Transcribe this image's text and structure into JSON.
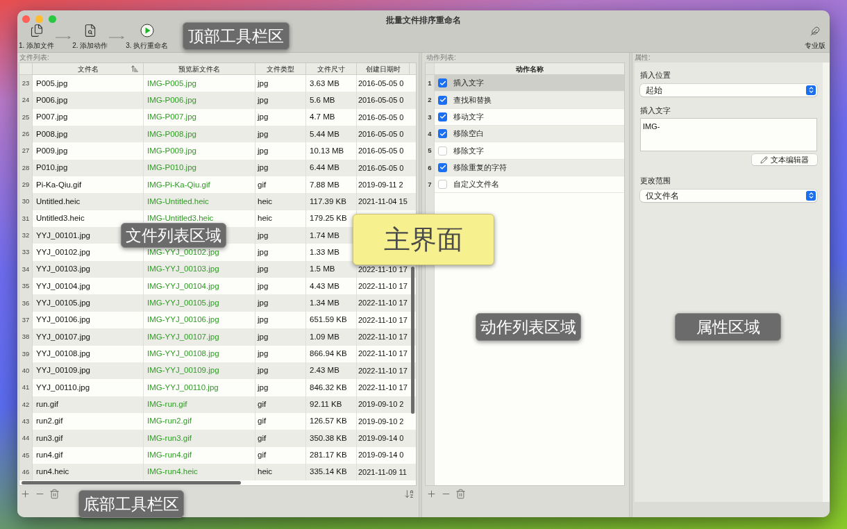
{
  "window": {
    "title": "批量文件排序重命名"
  },
  "toolbar": {
    "steps": [
      {
        "kind": "files",
        "label": "1. 添加文件"
      },
      {
        "kind": "actions",
        "label": "2. 添加动作"
      },
      {
        "kind": "run",
        "label": "3. 执行重命名"
      }
    ],
    "pro": {
      "label": "专业版"
    }
  },
  "file_list": {
    "label": "文件列表:",
    "columns": [
      {
        "label": "文件名",
        "sorted": true
      },
      {
        "label": "预览新文件名",
        "sorted": false
      },
      {
        "label": "文件类型",
        "sorted": false
      },
      {
        "label": "文件尺寸",
        "sorted": false
      },
      {
        "label": "创建日期时",
        "sorted": false
      }
    ],
    "rows": [
      {
        "index": "23",
        "name": "P005.jpg",
        "preview": "IMG-P005.jpg",
        "type": "jpg",
        "size": "3.63 MB",
        "created": "2016-05-05 0"
      },
      {
        "index": "24",
        "name": "P006.jpg",
        "preview": "IMG-P006.jpg",
        "type": "jpg",
        "size": "5.6 MB",
        "created": "2016-05-05 0"
      },
      {
        "index": "25",
        "name": "P007.jpg",
        "preview": "IMG-P007.jpg",
        "type": "jpg",
        "size": "4.7 MB",
        "created": "2016-05-05 0"
      },
      {
        "index": "26",
        "name": "P008.jpg",
        "preview": "IMG-P008.jpg",
        "type": "jpg",
        "size": "5.44 MB",
        "created": "2016-05-05 0"
      },
      {
        "index": "27",
        "name": "P009.jpg",
        "preview": "IMG-P009.jpg",
        "type": "jpg",
        "size": "10.13 MB",
        "created": "2016-05-05 0"
      },
      {
        "index": "28",
        "name": "P010.jpg",
        "preview": "IMG-P010.jpg",
        "type": "jpg",
        "size": "6.44 MB",
        "created": "2016-05-05 0"
      },
      {
        "index": "29",
        "name": "Pi-Ka-Qiu.gif",
        "preview": "IMG-Pi-Ka-Qiu.gif",
        "type": "gif",
        "size": "7.88 MB",
        "created": "2019-09-11 2"
      },
      {
        "index": "30",
        "name": "Untitled.heic",
        "preview": "IMG-Untitled.heic",
        "type": "heic",
        "size": "117.39 KB",
        "created": "2021-11-04 15"
      },
      {
        "index": "31",
        "name": "Untitled3.heic",
        "preview": "IMG-Untitled3.heic",
        "type": "heic",
        "size": "179.25 KB"
      },
      {
        "index": "32",
        "name": "YYJ_00101.jpg",
        "type": "jpg",
        "size": "1.74 MB"
      },
      {
        "index": "33",
        "name": "YYJ_00102.jpg",
        "preview": "IMG-YYJ_00102.jpg",
        "type": "jpg",
        "size": "1.33 MB"
      },
      {
        "index": "34",
        "name": "YYJ_00103.jpg",
        "preview": "IMG-YYJ_00103.jpg",
        "type": "jpg",
        "size": "1.5 MB",
        "created": "2022-11-10 17"
      },
      {
        "index": "35",
        "name": "YYJ_00104.jpg",
        "preview": "IMG-YYJ_00104.jpg",
        "type": "jpg",
        "size": "4.43 MB",
        "created": "2022-11-10 17"
      },
      {
        "index": "36",
        "name": "YYJ_00105.jpg",
        "preview": "IMG-YYJ_00105.jpg",
        "type": "jpg",
        "size": "1.34 MB",
        "created": "2022-11-10 17"
      },
      {
        "index": "37",
        "name": "YYJ_00106.jpg",
        "preview": "IMG-YYJ_00106.jpg",
        "type": "jpg",
        "size": "651.59 KB",
        "created": "2022-11-10 17"
      },
      {
        "index": "38",
        "name": "YYJ_00107.jpg",
        "preview": "IMG-YYJ_00107.jpg",
        "type": "jpg",
        "size": "1.09 MB",
        "created": "2022-11-10 17"
      },
      {
        "index": "39",
        "name": "YYJ_00108.jpg",
        "preview": "IMG-YYJ_00108.jpg",
        "type": "jpg",
        "size": "866.94 KB",
        "created": "2022-11-10 17"
      },
      {
        "index": "40",
        "name": "YYJ_00109.jpg",
        "preview": "IMG-YYJ_00109.jpg",
        "type": "jpg",
        "size": "2.43 MB",
        "created": "2022-11-10 17"
      },
      {
        "index": "41",
        "name": "YYJ_00110.jpg",
        "preview": "IMG-YYJ_00110.jpg",
        "type": "jpg",
        "size": "846.32 KB",
        "created": "2022-11-10 17"
      },
      {
        "index": "42",
        "name": "run.gif",
        "preview": "IMG-run.gif",
        "type": "gif",
        "size": "92.11 KB",
        "created": "2019-09-10 2"
      },
      {
        "index": "43",
        "name": "run2.gif",
        "preview": "IMG-run2.gif",
        "type": "gif",
        "size": "126.57 KB",
        "created": "2019-09-10 2"
      },
      {
        "index": "44",
        "name": "run3.gif",
        "preview": "IMG-run3.gif",
        "type": "gif",
        "size": "350.38 KB",
        "created": "2019-09-14 0"
      },
      {
        "index": "45",
        "name": "run4.gif",
        "preview": "IMG-run4.gif",
        "type": "gif",
        "size": "281.17 KB",
        "created": "2019-09-14 0"
      },
      {
        "index": "46",
        "name": "run4.heic",
        "preview": "IMG-run4.heic",
        "type": "heic",
        "size": "335.14 KB",
        "created": "2021-11-09 11"
      }
    ]
  },
  "action_list": {
    "label": "动作列表:",
    "column": "动作名称",
    "rows": [
      {
        "index": "1",
        "name": "插入文字",
        "checked": true,
        "selected": true
      },
      {
        "index": "2",
        "name": "查找和替换",
        "checked": true,
        "selected": false
      },
      {
        "index": "3",
        "name": "移动文字",
        "checked": true,
        "selected": false
      },
      {
        "index": "4",
        "name": "移除空白",
        "checked": true,
        "selected": false
      },
      {
        "index": "5",
        "name": "移除文字",
        "checked": false,
        "selected": false
      },
      {
        "index": "6",
        "name": "移除重复的字符",
        "checked": true,
        "selected": false
      },
      {
        "index": "7",
        "name": "自定义文件名",
        "checked": false,
        "selected": false
      }
    ]
  },
  "properties": {
    "label": "属性:",
    "insert_position": {
      "label": "插入位置",
      "value": "起始"
    },
    "insert_text": {
      "label": "插入文字",
      "value": "IMG-"
    },
    "editor_button": "文本编辑器",
    "scope": {
      "label": "更改范围",
      "value": "仅文件名"
    }
  },
  "annotations": [
    {
      "text": "顶部工具栏区",
      "kind": "dark"
    },
    {
      "text": "文件列表区域",
      "kind": "dark"
    },
    {
      "text": "主界面",
      "kind": "highlight"
    },
    {
      "text": "动作列表区域",
      "kind": "dark"
    },
    {
      "text": "属性区域",
      "kind": "dark"
    },
    {
      "text": "底部工具栏区",
      "kind": "dark"
    }
  ]
}
